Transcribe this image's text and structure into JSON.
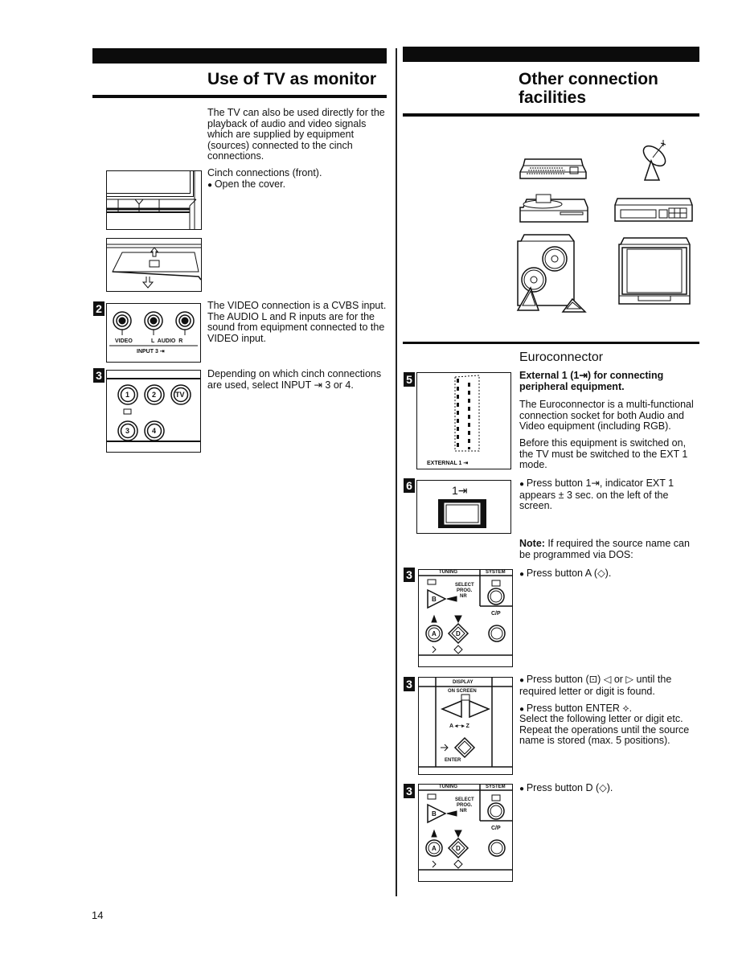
{
  "page_number": "14",
  "left": {
    "title": "Use of TV as monitor",
    "intro": "The TV can also be used directly for the playback of audio and video signals which are supplied by equipment (sources) connected to the cinch connections.",
    "front_label": "Cinch connections (front).",
    "open_cover": "Open the cover.",
    "video_text": "The VIDEO connection is a CVBS input. The AUDIO L and R inputs are for the sound from equipment connected to the VIDEO input.",
    "select_text": "Depending on which cinch connections are used, select INPUT ⇥ 3 or 4.",
    "fig2": {
      "step": "2",
      "video_label": "VIDEO",
      "audio_label": "L  AUDIO  R",
      "input_label": "INPUT 3 ⇥"
    },
    "fig3": {
      "step": "3",
      "buttons": [
        "1",
        "2",
        "TV",
        "3",
        "4"
      ],
      "input_icon": "⇥"
    }
  },
  "right": {
    "title_line1": "Other connection",
    "title_line2": "facilities",
    "devices": [
      "computer-keyboard",
      "satellite-dish",
      "record-player",
      "video-recorder",
      "speakers",
      "tv-monitor"
    ],
    "euro_title": "Euroconnector",
    "ext_heading": "External 1 (1⇥) for connecting peripheral equipment.",
    "euro_desc": "The Euroconnector is a multi-functional connection socket for both Audio and Video equipment (including RGB).",
    "before_text": "Before this equipment is switched on, the TV must be switched to the EXT 1 mode.",
    "press_ext": "Press button 1⇥, indicator EXT 1 appears ± 3 sec. on the left of the screen.",
    "note_label": "Note:",
    "note_text": " If required the source name can be programmed via DOS:",
    "press_a": "Press button A (◇).",
    "press_arrows": "Press button (⊡) ◁ or ▷ until the required letter or digit is found.",
    "press_enter": "Press button ENTER ⟡.",
    "select_following": "Select the following letter or digit etc. Repeat the operations until the source name is stored (max. 5 positions).",
    "press_d": "Press button D (◇).",
    "fig5": {
      "step": "5",
      "label": "EXTERNAL 1 ⇥"
    },
    "fig6": {
      "step": "6",
      "label": "1⇥"
    },
    "remote_a": {
      "step": "3",
      "tuning": "TUNING",
      "system": "SYSTEM",
      "select": "SELECT",
      "prog": "PROG.",
      "nr": "NR",
      "cp": "C/P",
      "btn_b": "B",
      "btn_a": "A",
      "btn_d": "D"
    },
    "remote_display": {
      "step": "3",
      "display": "DISPLAY",
      "on_screen": "ON SCREEN",
      "a_to_z": "A ◂─▸ Z",
      "enter": "ENTER"
    },
    "remote_d": {
      "step": "3",
      "tuning": "TUNING",
      "system": "SYSTEM",
      "select": "SELECT",
      "prog": "PROG.",
      "nr": "NR",
      "cp": "C/P",
      "btn_b": "B",
      "btn_a": "A",
      "btn_d": "D"
    }
  }
}
